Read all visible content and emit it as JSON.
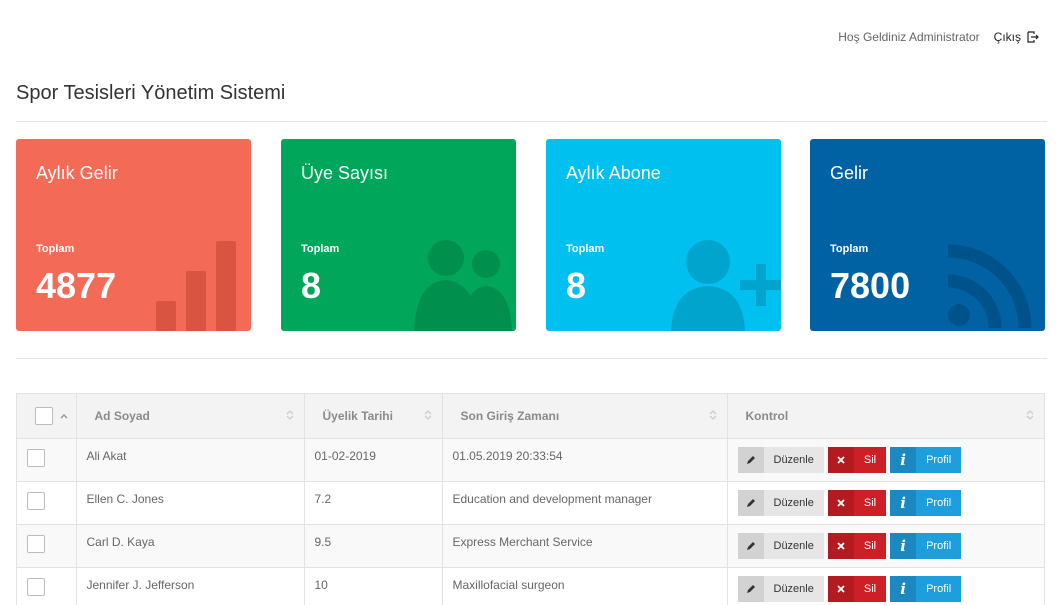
{
  "header": {
    "welcome": "Hoş Geldiniz Administrator",
    "logout_label": "Çıkış",
    "logout_icon": "logout-icon"
  },
  "page_title": "Spor Tesisleri Yönetim Sistemi",
  "cards": [
    {
      "title": "Aylık Gelir",
      "subtitle": "Toplam",
      "value": "4877",
      "color": "#f36a56",
      "icon": "bar-chart-icon"
    },
    {
      "title": "Üye Sayısı",
      "subtitle": "Toplam",
      "value": "8",
      "color": "#00a65a",
      "icon": "users-icon"
    },
    {
      "title": "Aylık Abone",
      "subtitle": "Toplam",
      "value": "8",
      "color": "#00c0ef",
      "icon": "user-plus-icon"
    },
    {
      "title": "Gelir",
      "subtitle": "Toplam",
      "value": "7800",
      "color": "#0062a3",
      "icon": "rss-icon"
    }
  ],
  "table": {
    "columns": [
      "Ad Soyad",
      "Üyelik Tarihi",
      "Son Giriş Zamanı",
      "Kontrol"
    ],
    "rows": [
      {
        "name": "Ali Akat",
        "date": "01-02-2019",
        "last": "01.05.2019 20:33:54"
      },
      {
        "name": "Ellen C. Jones",
        "date": "7.2",
        "last": "Education and development manager"
      },
      {
        "name": "Carl D. Kaya",
        "date": "9.5",
        "last": "Express Merchant Service"
      },
      {
        "name": "Jennifer J. Jefferson",
        "date": "10",
        "last": "Maxillofacial surgeon"
      }
    ],
    "actions": {
      "edit": "Düzenle",
      "delete": "Sil",
      "profile": "Profil"
    }
  }
}
